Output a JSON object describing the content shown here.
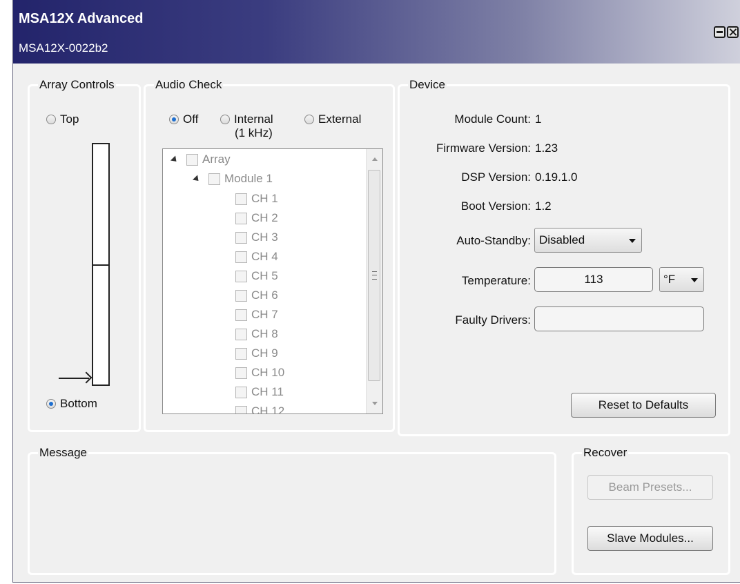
{
  "window": {
    "title": "MSA12X Advanced",
    "subtitle": "MSA12X-0022b2"
  },
  "array_controls": {
    "title": "Array Controls",
    "top_label": "Top",
    "bottom_label": "Bottom",
    "selected": "Bottom"
  },
  "audio_check": {
    "title": "Audio Check",
    "options": [
      "Off",
      "Internal",
      "External"
    ],
    "internal_sub": "(1 kHz)",
    "selected": "Off",
    "tree": {
      "root": "Array",
      "module": "Module 1",
      "channels": [
        "CH 1",
        "CH 2",
        "CH 3",
        "CH 4",
        "CH 5",
        "CH 6",
        "CH 7",
        "CH 8",
        "CH 9",
        "CH 10",
        "CH 11",
        "CH 12"
      ]
    }
  },
  "device": {
    "title": "Device",
    "module_count_label": "Module Count:",
    "module_count": "1",
    "firmware_label": "Firmware Version:",
    "firmware": "1.23",
    "dsp_label": "DSP Version:",
    "dsp": "0.19.1.0",
    "boot_label": "Boot Version:",
    "boot": "1.2",
    "standby_label": "Auto-Standby:",
    "standby_value": "Disabled",
    "temperature_label": "Temperature:",
    "temperature_value": "113",
    "temperature_unit": "°F",
    "faulty_label": "Faulty Drivers:",
    "faulty_value": "",
    "reset_label": "Reset to Defaults"
  },
  "message": {
    "title": "Message"
  },
  "recover": {
    "title": "Recover",
    "beam_presets_label": "Beam Presets...",
    "slave_modules_label": "Slave Modules..."
  }
}
